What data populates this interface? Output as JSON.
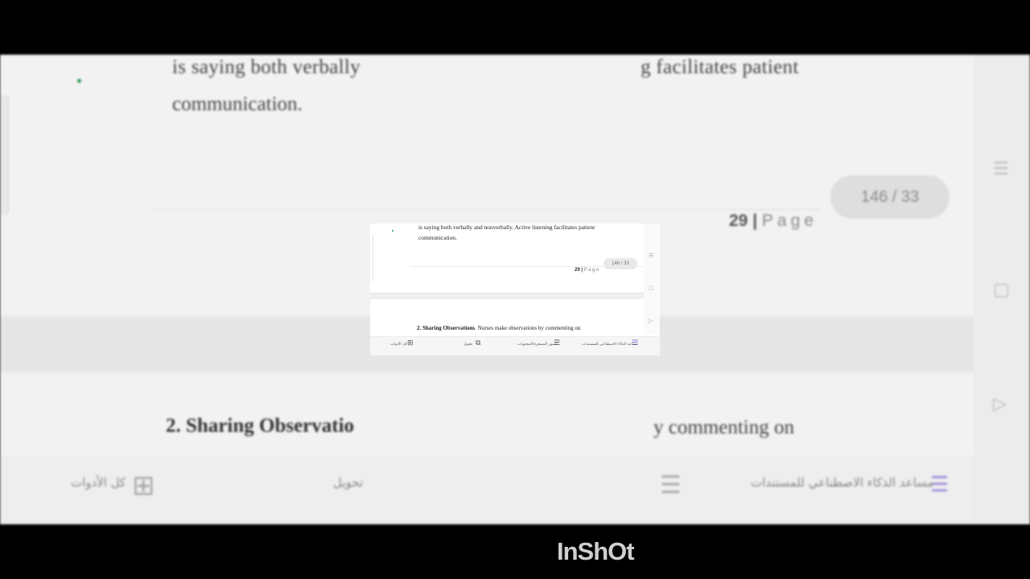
{
  "document": {
    "line1": "is saying both verbally and nonverbally. Active listening facilitates patient",
    "line1_bg_left": "is saying both verbally",
    "line1_bg_right": "g facilitates patient",
    "line2": "communication.",
    "page_label_num": "29",
    "page_label_sep": " | ",
    "page_label_word": "Page",
    "heading_num_title": "2. Sharing Observations",
    "heading_rest": ". Nurses make observations by commenting on",
    "bg_heading_left": "2. Sharing Observatio",
    "bg_heading_right": "y commenting on"
  },
  "page_indicator": "146 / 33",
  "toolbar": {
    "ai_assistant": "مساعد الذكاء الاصطناعي للمستندات",
    "outline": "الصور المصغرة/المحتويات",
    "convert": "تحويل",
    "all_tools": "كل الأدوات"
  },
  "icons": {
    "ai": "ai-sparkle-list-icon",
    "outline": "list-icon",
    "convert": "convert-icon",
    "all_tools": "grid-icon",
    "rail_menu": "menu-icon",
    "rail_square": "square-icon",
    "rail_play": "play-icon"
  },
  "watermark": "InShOt"
}
